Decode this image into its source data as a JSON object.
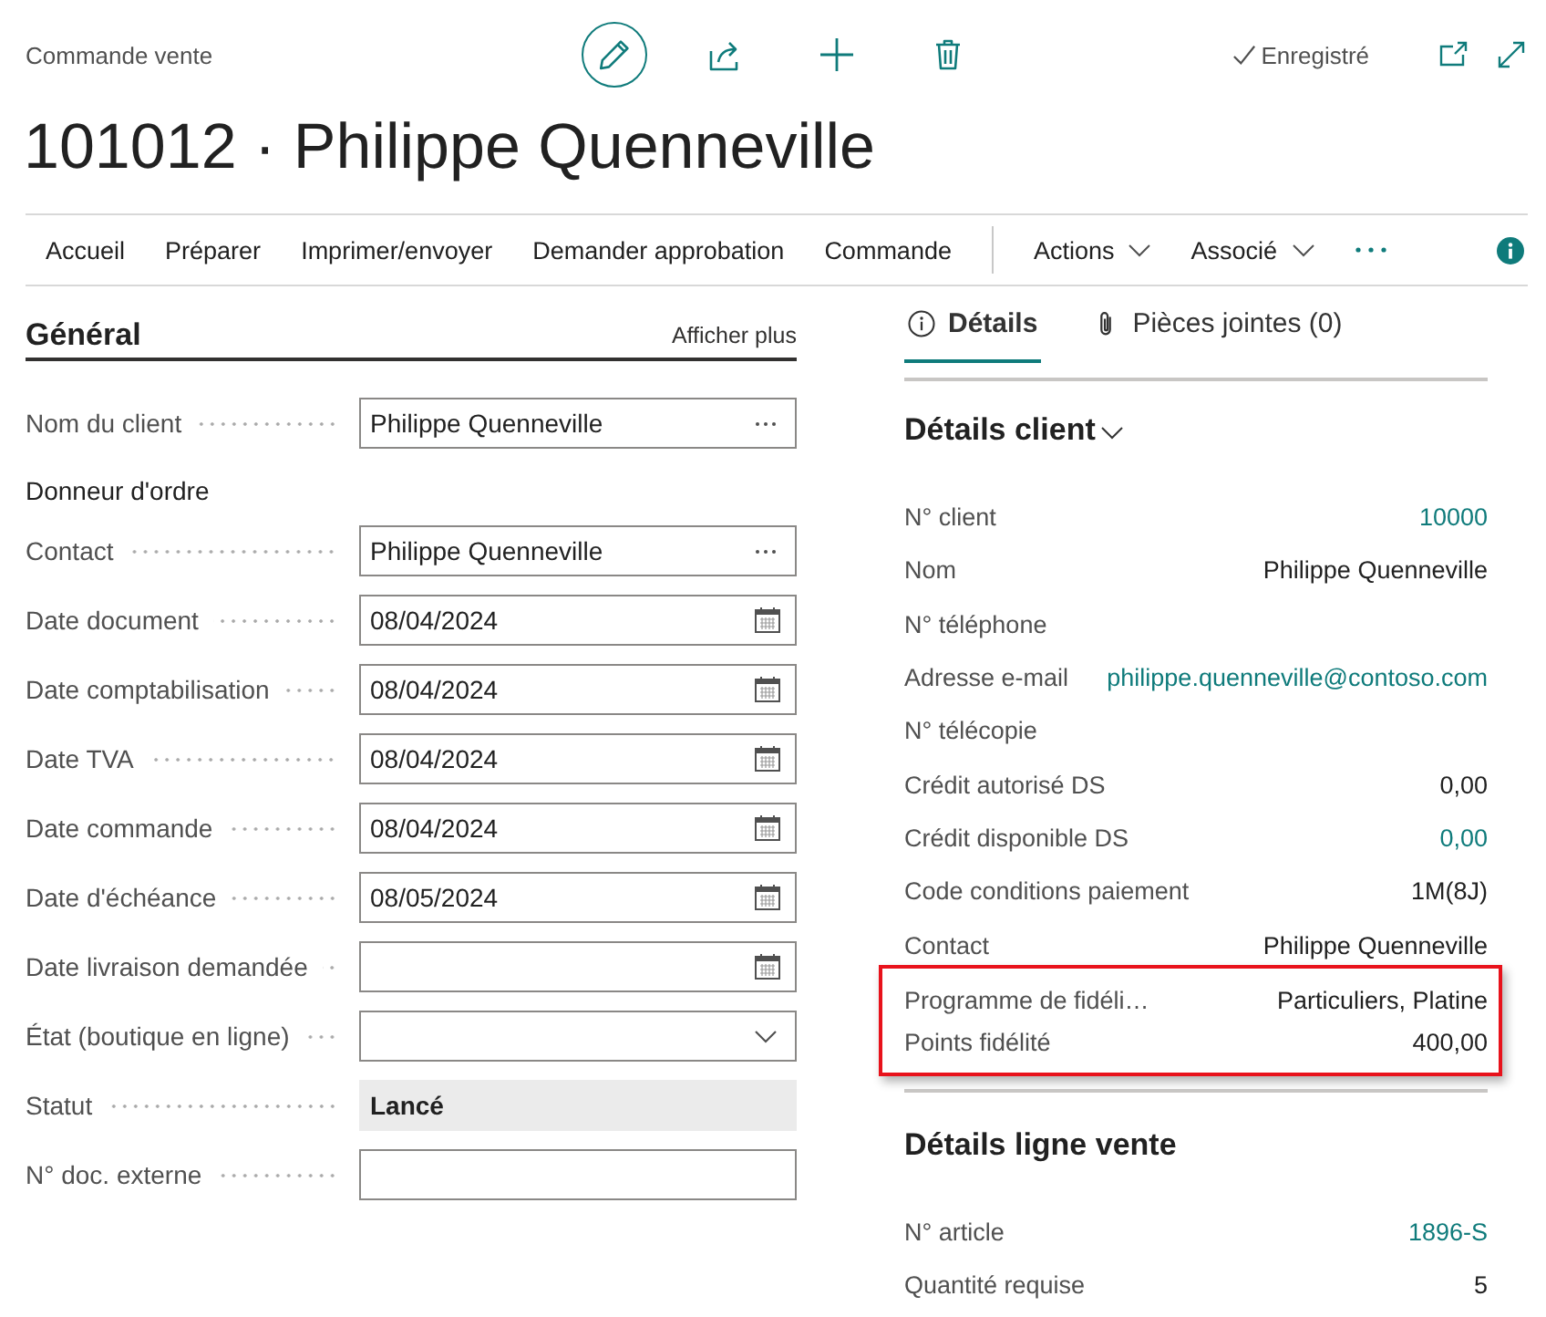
{
  "header": {
    "breadcrumb": "Commande vente",
    "save_status": "Enregistré",
    "title": "101012 · Philippe Quenneville"
  },
  "action_bar": {
    "groups": [
      {
        "items": [
          {
            "label": "Accueil",
            "kind": "action"
          },
          {
            "label": "Préparer",
            "kind": "action"
          },
          {
            "label": "Imprimer/envoyer",
            "kind": "action"
          },
          {
            "label": "Demander approbation",
            "kind": "action"
          },
          {
            "label": "Commande",
            "kind": "action"
          }
        ]
      },
      {
        "items": [
          {
            "label": "Actions",
            "kind": "menu"
          },
          {
            "label": "Associé",
            "kind": "menu"
          }
        ]
      }
    ]
  },
  "general": {
    "title": "Général",
    "show_more": "Afficher plus",
    "fields": [
      {
        "kind": "lookup",
        "label": "Nom du client",
        "value": "Philippe Quenneville"
      },
      {
        "kind": "group",
        "label": "Donneur d'ordre"
      },
      {
        "kind": "lookup",
        "label": "Contact",
        "value": "Philippe Quenneville"
      },
      {
        "kind": "date",
        "label": "Date document",
        "value": "08/04/2024"
      },
      {
        "kind": "date",
        "label": "Date comptabilisation",
        "value": "08/04/2024"
      },
      {
        "kind": "date",
        "label": "Date TVA",
        "value": "08/04/2024"
      },
      {
        "kind": "date",
        "label": "Date commande",
        "value": "08/04/2024"
      },
      {
        "kind": "date",
        "label": "Date d'échéance",
        "value": "08/05/2024"
      },
      {
        "kind": "date",
        "label": "Date livraison demandée"
      },
      {
        "kind": "dropdown",
        "label": "État (boutique en ligne)"
      },
      {
        "kind": "readonly",
        "label": "Statut",
        "value": "Lancé"
      },
      {
        "kind": "text",
        "label": "N° doc. externe"
      }
    ]
  },
  "details_pane": {
    "tabs": [
      {
        "label": "Détails",
        "kind": "details",
        "selected": true
      },
      {
        "label": "Pièces jointes (0)",
        "kind": "attachments",
        "selected": false
      }
    ],
    "sections": [
      {
        "title": "Détails client",
        "collapsible": true,
        "rows": [
          {
            "label": "N° client",
            "value": "10000",
            "link": true
          },
          {
            "label": "Nom",
            "value": "Philippe Quenneville",
            "link": false
          },
          {
            "label": "N° téléphone"
          },
          {
            "label": "Adresse e-mail",
            "value": "philippe.quenneville@contoso.com",
            "link": true
          },
          {
            "label": "N° télécopie"
          },
          {
            "label": "Crédit autorisé DS",
            "value": "0,00",
            "link": false
          },
          {
            "label": "Crédit disponible DS",
            "value": "0,00",
            "link": true
          },
          {
            "label": "Code conditions paiement",
            "value": "1M(8J)",
            "link": false
          },
          {
            "label": "Contact",
            "value": "Philippe Quenneville",
            "link": false
          }
        ],
        "highlighted_rows": [
          {
            "label": "Programme de fidéli…",
            "value": "Particuliers, Platine",
            "link": false
          },
          {
            "label": "Points fidélité",
            "value": "400,00",
            "link": false
          }
        ]
      },
      {
        "title": "Détails ligne vente",
        "collapsible": false,
        "rows": [
          {
            "label": "N° article",
            "value": "1896-S",
            "link": true
          },
          {
            "label": "Quantité requise",
            "value": "5",
            "link": false
          }
        ]
      }
    ]
  }
}
